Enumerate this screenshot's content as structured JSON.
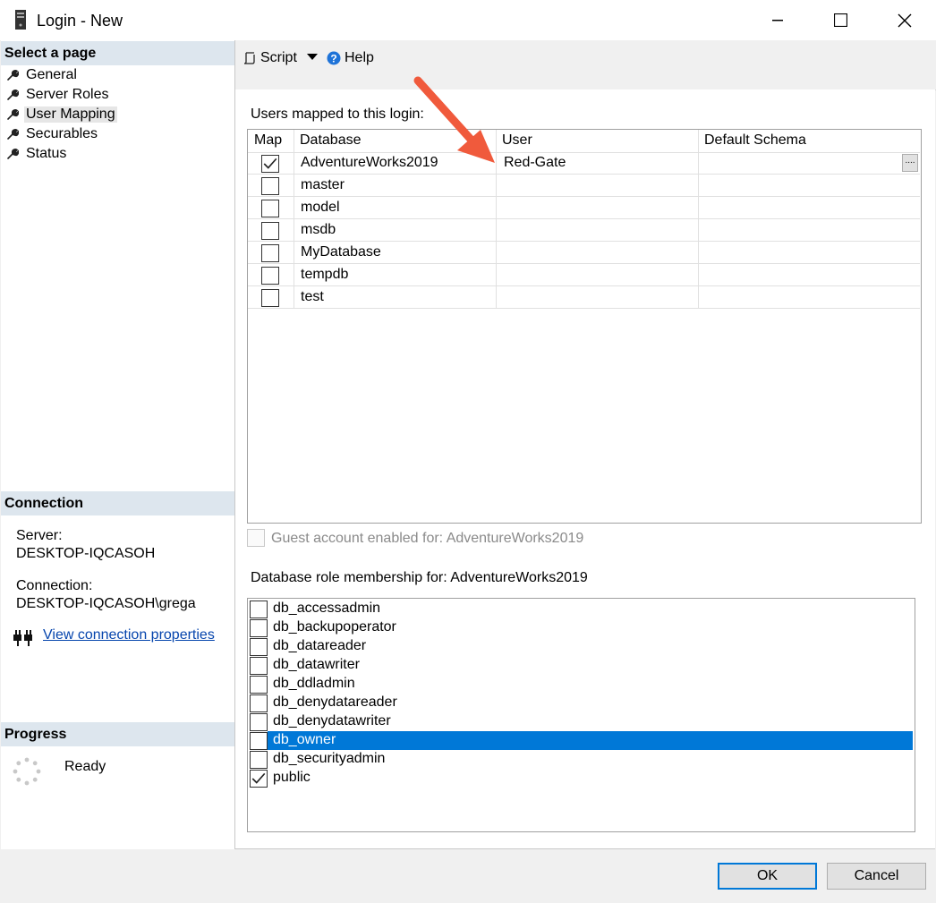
{
  "window": {
    "title": "Login - New"
  },
  "left": {
    "select_page_title": "Select a page",
    "pages": [
      "General",
      "Server Roles",
      "User Mapping",
      "Securables",
      "Status"
    ],
    "selected_page": "User Mapping",
    "connection_title": "Connection",
    "server_label": "Server:",
    "server_value": "DESKTOP-IQCASOH",
    "connection_label": "Connection:",
    "connection_value": "DESKTOP-IQCASOH\\grega",
    "view_connection_link": "View connection properties",
    "progress_title": "Progress",
    "progress_status": "Ready"
  },
  "toolbar": {
    "script_label": "Script",
    "help_label": "Help"
  },
  "mapping": {
    "section_label": "Users mapped to this login:",
    "columns": [
      "Map",
      "Database",
      "User",
      "Default Schema"
    ],
    "rows": [
      {
        "map": true,
        "database": "AdventureWorks2019",
        "user": "Red-Gate",
        "schema": ""
      },
      {
        "map": false,
        "database": "master",
        "user": "",
        "schema": ""
      },
      {
        "map": false,
        "database": "model",
        "user": "",
        "schema": ""
      },
      {
        "map": false,
        "database": "msdb",
        "user": "",
        "schema": ""
      },
      {
        "map": false,
        "database": "MyDatabase",
        "user": "",
        "schema": ""
      },
      {
        "map": false,
        "database": "tempdb",
        "user": "",
        "schema": ""
      },
      {
        "map": false,
        "database": "test",
        "user": "",
        "schema": ""
      }
    ],
    "ellipsis_label": "...."
  },
  "guest": {
    "label": "Guest account enabled for: AdventureWorks2019",
    "checked": false
  },
  "roles": {
    "section_label": "Database role membership for: AdventureWorks2019",
    "items": [
      {
        "name": "db_accessadmin",
        "checked": false,
        "selected": false
      },
      {
        "name": "db_backupoperator",
        "checked": false,
        "selected": false
      },
      {
        "name": "db_datareader",
        "checked": false,
        "selected": false
      },
      {
        "name": "db_datawriter",
        "checked": false,
        "selected": false
      },
      {
        "name": "db_ddladmin",
        "checked": false,
        "selected": false
      },
      {
        "name": "db_denydatareader",
        "checked": false,
        "selected": false
      },
      {
        "name": "db_denydatawriter",
        "checked": false,
        "selected": false
      },
      {
        "name": "db_owner",
        "checked": false,
        "selected": true
      },
      {
        "name": "db_securityadmin",
        "checked": false,
        "selected": false
      },
      {
        "name": "public",
        "checked": true,
        "selected": false
      }
    ]
  },
  "buttons": {
    "ok": "OK",
    "cancel": "Cancel"
  },
  "colors": {
    "selection": "#0078d7",
    "link": "#0645ad",
    "arrow": "#f05a3c",
    "section_header": "#dde6ee"
  }
}
